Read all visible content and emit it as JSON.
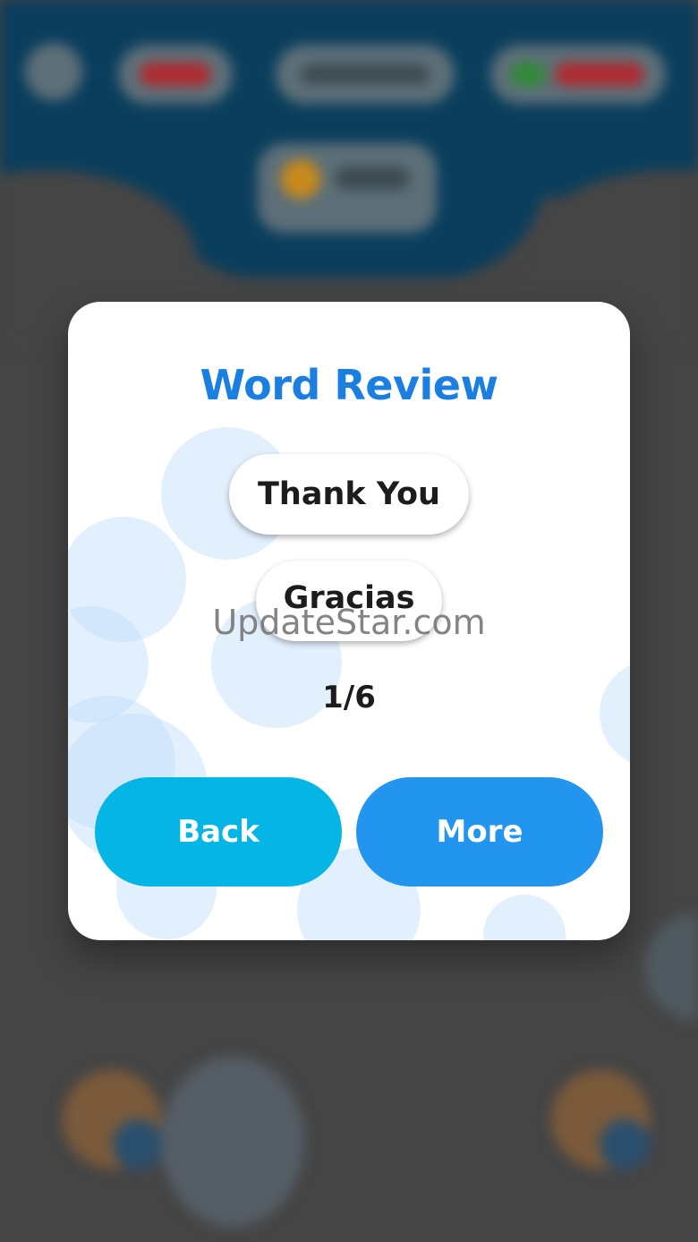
{
  "modal": {
    "title": "Word Review",
    "word": "Thank You",
    "translation": "Gracias",
    "counter": "1/6",
    "back_label": "Back",
    "more_label": "More"
  },
  "watermark": "UpdateStar.com",
  "colors": {
    "title": "#1a7fe0",
    "back_button": "#05b5e6",
    "more_button": "#2295ef",
    "overlay": "#454545",
    "header": "#0a3e5c"
  }
}
